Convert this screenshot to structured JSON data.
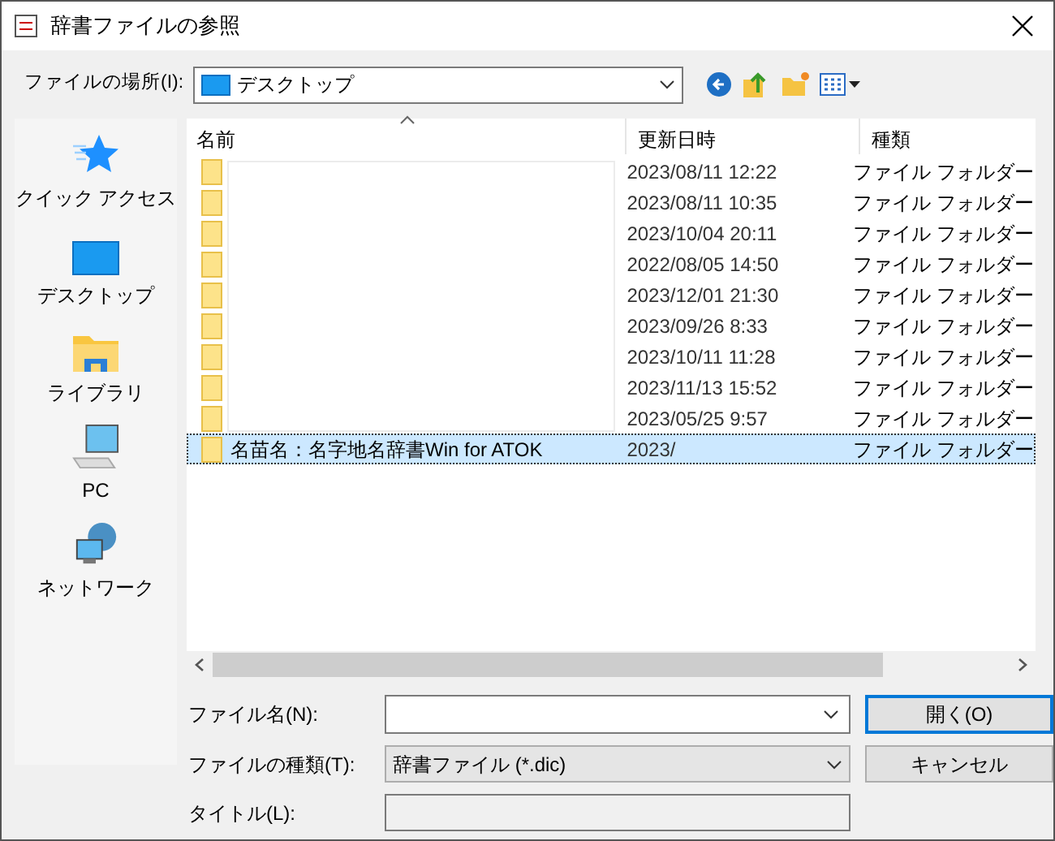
{
  "window": {
    "title": "辞書ファイルの参照"
  },
  "location": {
    "label": "ファイルの場所(I):",
    "value": "デスクトップ"
  },
  "sidebar": {
    "items": [
      {
        "kind": "star",
        "label": "クイック アクセス"
      },
      {
        "kind": "desktop",
        "label": "デスクトップ"
      },
      {
        "kind": "library",
        "label": "ライブラリ"
      },
      {
        "kind": "pc",
        "label": "PC"
      },
      {
        "kind": "network",
        "label": "ネットワーク"
      }
    ]
  },
  "table": {
    "columns": [
      "名前",
      "更新日時",
      "種類"
    ],
    "rows": [
      {
        "name": "",
        "date": "2023/08/11 12:22",
        "type": "ファイル フォルダー",
        "selected": false
      },
      {
        "name": "",
        "date": "2023/08/11 10:35",
        "type": "ファイル フォルダー",
        "selected": false
      },
      {
        "name": "",
        "date": "2023/10/04 20:11",
        "type": "ファイル フォルダー",
        "selected": false
      },
      {
        "name": "",
        "date": "2022/08/05 14:50",
        "type": "ファイル フォルダー",
        "selected": false
      },
      {
        "name": "",
        "date": "2023/12/01 21:30",
        "type": "ファイル フォルダー",
        "selected": false
      },
      {
        "name": "",
        "date": "2023/09/26 8:33",
        "type": "ファイル フォルダー",
        "selected": false
      },
      {
        "name": "",
        "date": "2023/10/11 11:28",
        "type": "ファイル フォルダー",
        "selected": false
      },
      {
        "name": "",
        "date": "2023/11/13 15:52",
        "type": "ファイル フォルダー",
        "selected": false
      },
      {
        "name": "",
        "date": "2023/05/25 9:57",
        "type": "ファイル フォルダー",
        "selected": false
      },
      {
        "name": "名苗名：名字地名辞書Win for ATOK",
        "date": "2023/",
        "type": "ファイル フォルダー",
        "selected": true
      }
    ]
  },
  "form": {
    "file_name": {
      "label": "ファイル名(N):"
    },
    "file_type": {
      "label": "ファイルの種類(T):",
      "value": "辞書ファイル (*.dic)"
    },
    "title": {
      "label": "タイトル(L):"
    }
  },
  "buttons": [
    {
      "label": "開く(O)",
      "default": true
    },
    {
      "label": "キャンセル",
      "default": false
    }
  ]
}
